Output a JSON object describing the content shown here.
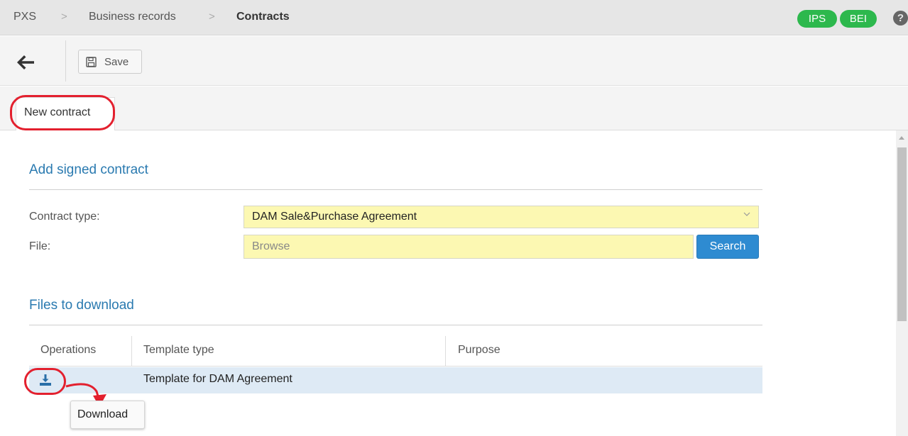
{
  "breadcrumb": {
    "items": [
      "PXS",
      "Business records",
      "Contracts"
    ],
    "separator": ">"
  },
  "badges": [
    "IPS",
    "BEI"
  ],
  "help": {
    "label": "?"
  },
  "toolbar": {
    "back_icon": "arrow-left-icon",
    "save_icon": "floppy-disk-icon",
    "save_label": "Save"
  },
  "tabs": [
    {
      "label": "New contract",
      "active": true
    }
  ],
  "add_section": {
    "title": "Add signed contract",
    "contract_type_label": "Contract type:",
    "contract_type_value": "DAM Sale&Purchase Agreement",
    "file_label": "File:",
    "file_placeholder": "Browse",
    "search_label": "Search"
  },
  "files_section": {
    "title": "Files to download",
    "columns": [
      "Operations",
      "Template type",
      "Purpose"
    ],
    "rows": [
      {
        "operation_icon": "download-icon",
        "template_type": "Template for DAM Agreement",
        "purpose": ""
      }
    ]
  },
  "tooltip": {
    "label": "Download"
  },
  "colors": {
    "accent_blue": "#2a7ab0",
    "badge_green": "#2db84d",
    "field_yellow": "#fcf8b2",
    "annotation_red": "#e3202e",
    "row_highlight": "#deeaf5"
  }
}
